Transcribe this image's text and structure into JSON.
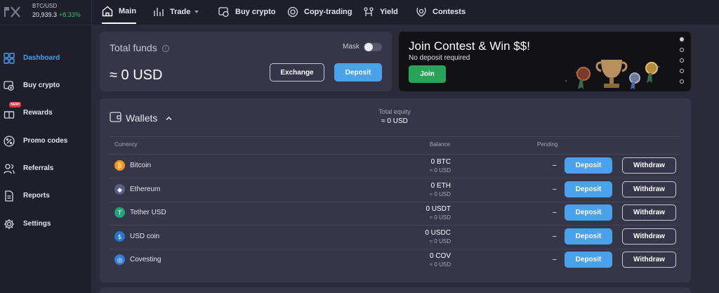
{
  "ticker": {
    "pair": "BTC/USD",
    "price": "20,939.3",
    "change": "+8.33%"
  },
  "sidebar": {
    "items": [
      {
        "label": "Dashboard",
        "icon": "dashboard-icon",
        "active": true
      },
      {
        "label": "Buy crypto",
        "icon": "buy-crypto-icon"
      },
      {
        "label": "Rewards",
        "icon": "gift-icon",
        "badge": "NEW!"
      },
      {
        "label": "Promo codes",
        "icon": "percent-icon"
      },
      {
        "label": "Referrals",
        "icon": "users-icon"
      },
      {
        "label": "Reports",
        "icon": "document-icon"
      },
      {
        "label": "Settings",
        "icon": "gear-icon"
      }
    ]
  },
  "topnav": {
    "tabs": [
      {
        "label": "Main",
        "icon": "home-icon",
        "active": true
      },
      {
        "label": "Trade",
        "icon": "chart-icon",
        "dropdown": true
      },
      {
        "label": "Buy crypto",
        "icon": "wallet-card-icon"
      },
      {
        "label": "Copy-trading",
        "icon": "copy-trading-icon"
      },
      {
        "label": "Yield",
        "icon": "yield-icon"
      },
      {
        "label": "Contests",
        "icon": "laurel-icon"
      }
    ]
  },
  "funds": {
    "title": "Total funds",
    "mask_label": "Mask",
    "value": "≈ 0 USD",
    "exchange_label": "Exchange",
    "deposit_label": "Deposit"
  },
  "banner": {
    "title": "Join Contest & Win $$!",
    "subtitle": "No deposit required",
    "button": "Join"
  },
  "wallets": {
    "title": "Wallets",
    "equity_label": "Total equity",
    "equity_value": "≈ 0 USD",
    "headers": {
      "currency": "Currency",
      "balance": "Balance",
      "pending": "Pending"
    },
    "rows": [
      {
        "name": "Bitcoin",
        "balance": "0 BTC",
        "usd": "≈ 0 USD",
        "pending": "–",
        "color": "#f7931a",
        "glyph": "₿"
      },
      {
        "name": "Ethereum",
        "balance": "0 ETH",
        "usd": "≈ 0 USD",
        "pending": "–",
        "color": "#5a5f86",
        "glyph": "◆"
      },
      {
        "name": "Tether USD",
        "balance": "0 USDT",
        "usd": "≈ 0 USD",
        "pending": "–",
        "color": "#26a17b",
        "glyph": "T"
      },
      {
        "name": "USD coin",
        "balance": "0 USDC",
        "usd": "≈ 0 USD",
        "pending": "–",
        "color": "#2775ca",
        "glyph": "$"
      },
      {
        "name": "Covesting",
        "balance": "0 COV",
        "usd": "≈ 0 USD",
        "pending": "–",
        "color": "#3a7bd5",
        "glyph": "◎"
      }
    ],
    "deposit_label": "Deposit",
    "withdraw_label": "Withdraw"
  },
  "colors": {
    "accent": "#4aa3ea",
    "positive": "#3fbf6a",
    "join": "#27a45a",
    "card": "#36364a",
    "sidebar": "#1f1f2c"
  }
}
